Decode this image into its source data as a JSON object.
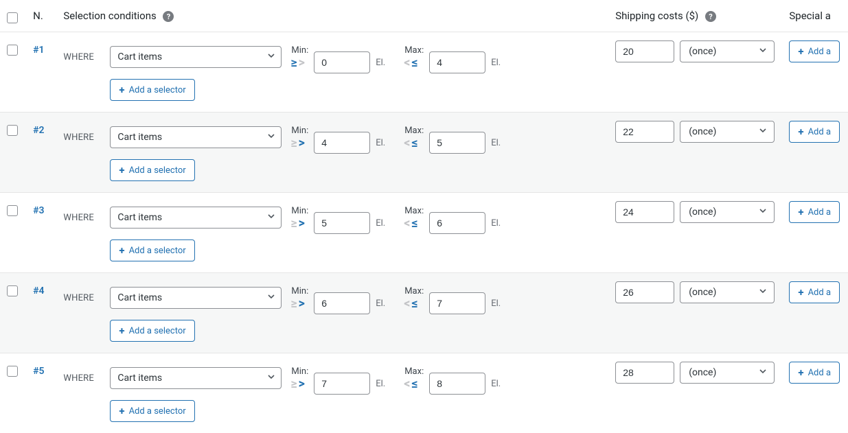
{
  "headers": {
    "n": "N.",
    "conditions": "Selection conditions",
    "shipping": "Shipping costs ($)",
    "special": "Special a"
  },
  "labels": {
    "where": "WHERE",
    "min": "Min:",
    "max": "Max:",
    "el": "El.",
    "add_selector": "Add a selector",
    "add_action": "Add a",
    "help": "?"
  },
  "selector_option": "Cart items",
  "freq_option": "(once)",
  "rows": [
    {
      "num": "#1",
      "min": "0",
      "max": "4",
      "cost": "20",
      "min_mode": "gte",
      "cost_focused": false,
      "alt": false
    },
    {
      "num": "#2",
      "min": "4",
      "max": "5",
      "cost": "22",
      "min_mode": "gt",
      "cost_focused": false,
      "alt": true
    },
    {
      "num": "#3",
      "min": "5",
      "max": "6",
      "cost": "24",
      "min_mode": "gt",
      "cost_focused": true,
      "alt": false
    },
    {
      "num": "#4",
      "min": "6",
      "max": "7",
      "cost": "26",
      "min_mode": "gt",
      "cost_focused": false,
      "alt": true
    },
    {
      "num": "#5",
      "min": "7",
      "max": "8",
      "cost": "28",
      "min_mode": "gt",
      "cost_focused": false,
      "alt": false
    }
  ]
}
